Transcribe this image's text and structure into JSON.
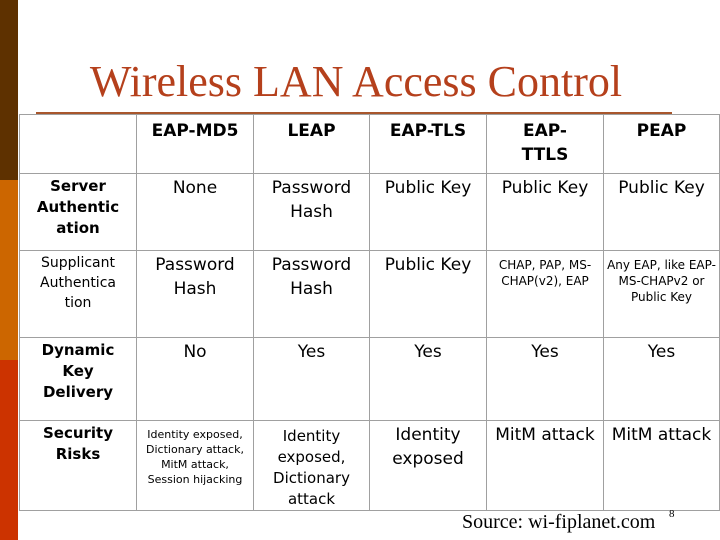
{
  "slide": {
    "title": "Wireless LAN Access Control",
    "source": "Source: wi-fiplanet.com",
    "page_number": "8",
    "colors": {
      "title": "#b5401c",
      "title_rule": "#a8562c",
      "sidebar_top": "#5e3100",
      "sidebar_mid": "#cc6600",
      "sidebar_bottom": "#cc3300",
      "grid_lines": "#a0a0a0"
    }
  },
  "table": {
    "columns": [
      "",
      "EAP-MD5",
      "LEAP",
      "EAP-TLS",
      "EAP-TTLS",
      "PEAP"
    ],
    "header_lines": {
      "eap_ttls": [
        "EAP-",
        "TTLS"
      ]
    },
    "rows": [
      {
        "label": "Server Authentication",
        "label_lines": [
          "Server",
          "Authentic",
          "ation"
        ],
        "cells": [
          "None",
          "Password Hash",
          "Public Key",
          "Public Key",
          "Public Key"
        ]
      },
      {
        "label": "Supplicant Authentication",
        "label_lines": [
          "Supplicant",
          "Authentica",
          "tion"
        ],
        "cells": [
          "Password Hash",
          "Password Hash",
          "Public Key",
          "CHAP, PAP, MS-CHAP(v2), EAP",
          "Any EAP, like EAP-MS-CHAPv2 or Public Key"
        ]
      },
      {
        "label": "Dynamic Key Delivery",
        "label_lines": [
          "Dynamic",
          "Key",
          "Delivery"
        ],
        "cells": [
          "No",
          "Yes",
          "Yes",
          "Yes",
          "Yes"
        ]
      },
      {
        "label": "Security Risks",
        "label_lines": [
          "Security",
          "Risks"
        ],
        "cells": [
          "Identity exposed, Dictionary attack, MitM attack, Session hijacking",
          "Identity exposed, Dictionary attack",
          "Identity exposed",
          "MitM attack",
          "MitM attack"
        ]
      }
    ]
  }
}
